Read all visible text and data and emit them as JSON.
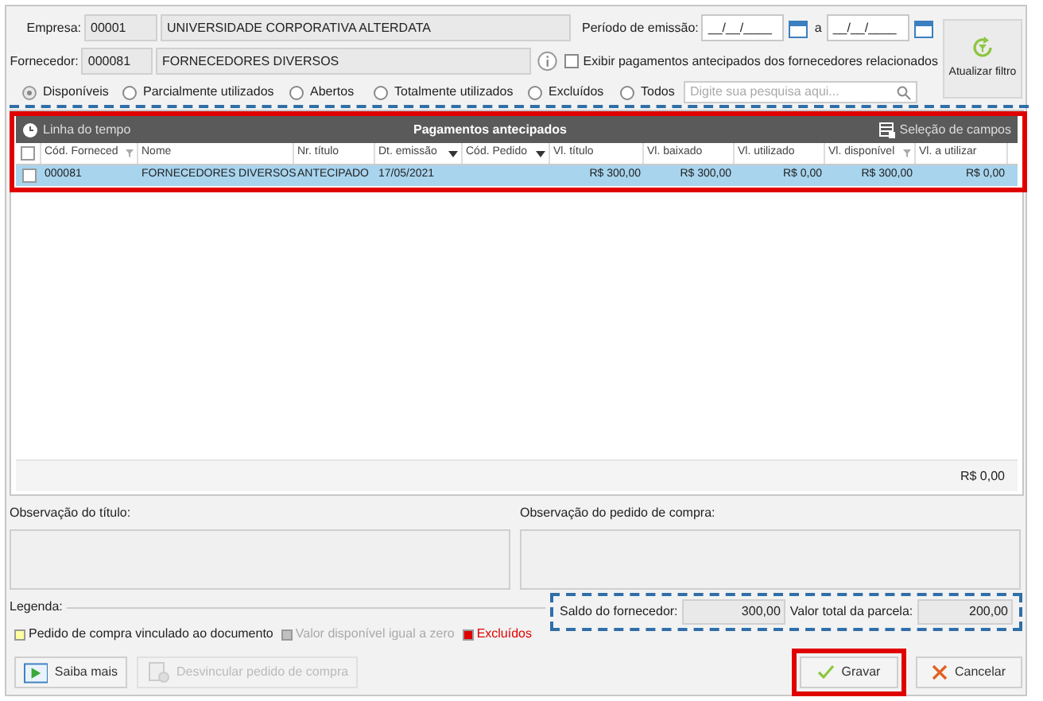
{
  "empresa": {
    "label": "Empresa:",
    "code": "00001",
    "name": "UNIVERSIDADE CORPORATIVA ALTERDATA"
  },
  "periodo": {
    "label": "Período de emissão:",
    "from": "__/__/____",
    "separator": "a",
    "to": "__/__/____"
  },
  "fornecedor": {
    "label": "Fornecedor:",
    "code": "000081",
    "name": "FORNECEDORES DIVERSOS"
  },
  "exibir_relacionados": {
    "label": "Exibir pagamentos antecipados dos fornecedores relacionados",
    "checked": false
  },
  "refresh_button": {
    "label": "Atualizar filtro"
  },
  "filters": [
    {
      "label": "Disponíveis",
      "selected": true
    },
    {
      "label": "Parcialmente utilizados",
      "selected": false
    },
    {
      "label": "Abertos",
      "selected": false
    },
    {
      "label": "Totalmente utilizados",
      "selected": false
    },
    {
      "label": "Excluídos",
      "selected": false
    },
    {
      "label": "Todos",
      "selected": false
    }
  ],
  "search": {
    "placeholder": "Digite sua pesquisa aqui..."
  },
  "grid": {
    "timeline_label": "Linha do tempo",
    "title": "Pagamentos antecipados",
    "fields_label": "Seleção de campos",
    "columns": [
      {
        "label": "Cód. Forneced",
        "sorted": false,
        "filtered": true
      },
      {
        "label": "Nome",
        "sorted": false,
        "filtered": false
      },
      {
        "label": "Nr. título",
        "sorted": false,
        "filtered": false
      },
      {
        "label": "Dt. emissão",
        "sorted": true,
        "filtered": false
      },
      {
        "label": "Cód. Pedido",
        "sorted": true,
        "filtered": false
      },
      {
        "label": "Vl. título",
        "sorted": false,
        "filtered": false
      },
      {
        "label": "Vl. baixado",
        "sorted": false,
        "filtered": false
      },
      {
        "label": "Vl. utilizado",
        "sorted": false,
        "filtered": false
      },
      {
        "label": "Vl. disponível",
        "sorted": false,
        "filtered": true
      },
      {
        "label": "Vl. a utilizar",
        "sorted": false,
        "filtered": false
      }
    ],
    "rows": [
      {
        "checked": false,
        "selected": true,
        "cells": [
          "000081",
          "FORNECEDORES DIVERSOS",
          "ANTECIPADO",
          "17/05/2021",
          "",
          "R$ 300,00",
          "R$ 300,00",
          "R$ 0,00",
          "R$ 300,00",
          "R$ 0,00"
        ]
      }
    ],
    "footer_total": "R$ 0,00",
    "header_checked": false
  },
  "obs_titulo": {
    "label": "Observação do título:"
  },
  "obs_pedido": {
    "label": "Observação do pedido de compra:"
  },
  "legend": {
    "label": "Legenda:",
    "items": [
      {
        "label": "Pedido de compra vinculado ao documento",
        "color": "#ffffa0",
        "kind": "normal"
      },
      {
        "label": "Valor disponível igual a zero",
        "color": "#c0c0c0",
        "kind": "muted"
      },
      {
        "label": "Excluídos",
        "color": "#e00000",
        "kind": "alert"
      }
    ]
  },
  "saldo": {
    "label": "Saldo do fornecedor:",
    "value": "300,00"
  },
  "valor_parcela": {
    "label": "Valor total da parcela:",
    "value": "200,00"
  },
  "buttons": [
    {
      "label": "Saiba mais",
      "kind": "help",
      "disabled": false
    },
    {
      "label": "Desvincular pedido de compra",
      "kind": "unlink",
      "disabled": true
    },
    {
      "label": "Gravar",
      "kind": "save",
      "disabled": false
    },
    {
      "label": "Cancelar",
      "kind": "cancel",
      "disabled": false
    }
  ]
}
